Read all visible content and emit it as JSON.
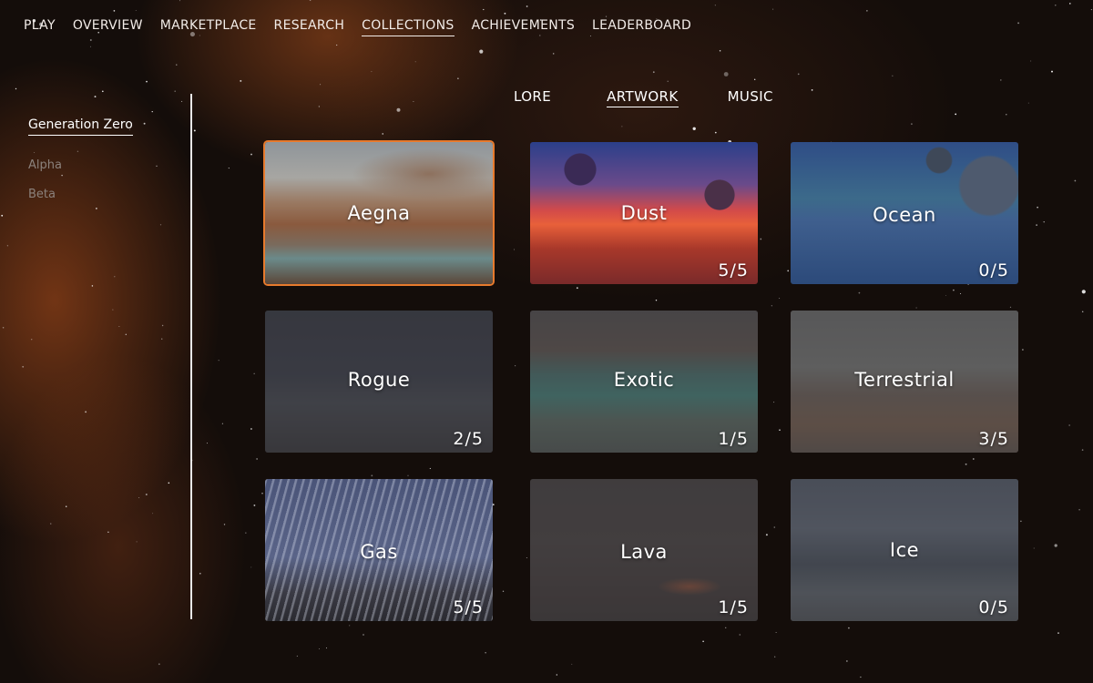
{
  "topnav": {
    "items": [
      {
        "label": "PLAY",
        "active": false
      },
      {
        "label": "OVERVIEW",
        "active": false
      },
      {
        "label": "MARKETPLACE",
        "active": false
      },
      {
        "label": "RESEARCH",
        "active": false
      },
      {
        "label": "COLLECTIONS",
        "active": true
      },
      {
        "label": "ACHIEVEMENTS",
        "active": false
      },
      {
        "label": "LEADERBOARD",
        "active": false
      }
    ]
  },
  "sidebar": {
    "items": [
      {
        "label": "Generation Zero",
        "active": true
      },
      {
        "label": "Alpha",
        "active": false
      },
      {
        "label": "Beta",
        "active": false
      }
    ]
  },
  "subtabs": {
    "items": [
      {
        "label": "LORE",
        "active": false
      },
      {
        "label": "ARTWORK",
        "active": true
      },
      {
        "label": "MUSIC",
        "active": false
      }
    ]
  },
  "cards": [
    {
      "title": "Aegna",
      "count": "",
      "selected": true
    },
    {
      "title": "Dust",
      "count": "5/5",
      "selected": false
    },
    {
      "title": "Ocean",
      "count": "0/5",
      "selected": false
    },
    {
      "title": "Rogue",
      "count": "2/5",
      "selected": false
    },
    {
      "title": "Exotic",
      "count": "1/5",
      "selected": false
    },
    {
      "title": "Terrestrial",
      "count": "3/5",
      "selected": false
    },
    {
      "title": "Gas",
      "count": "5/5",
      "selected": false
    },
    {
      "title": "Lava",
      "count": "1/5",
      "selected": false
    },
    {
      "title": "Ice",
      "count": "0/5",
      "selected": false
    }
  ],
  "colors": {
    "accent": "#e77a2d",
    "text": "#ffffff",
    "muted": "#8b817b"
  }
}
